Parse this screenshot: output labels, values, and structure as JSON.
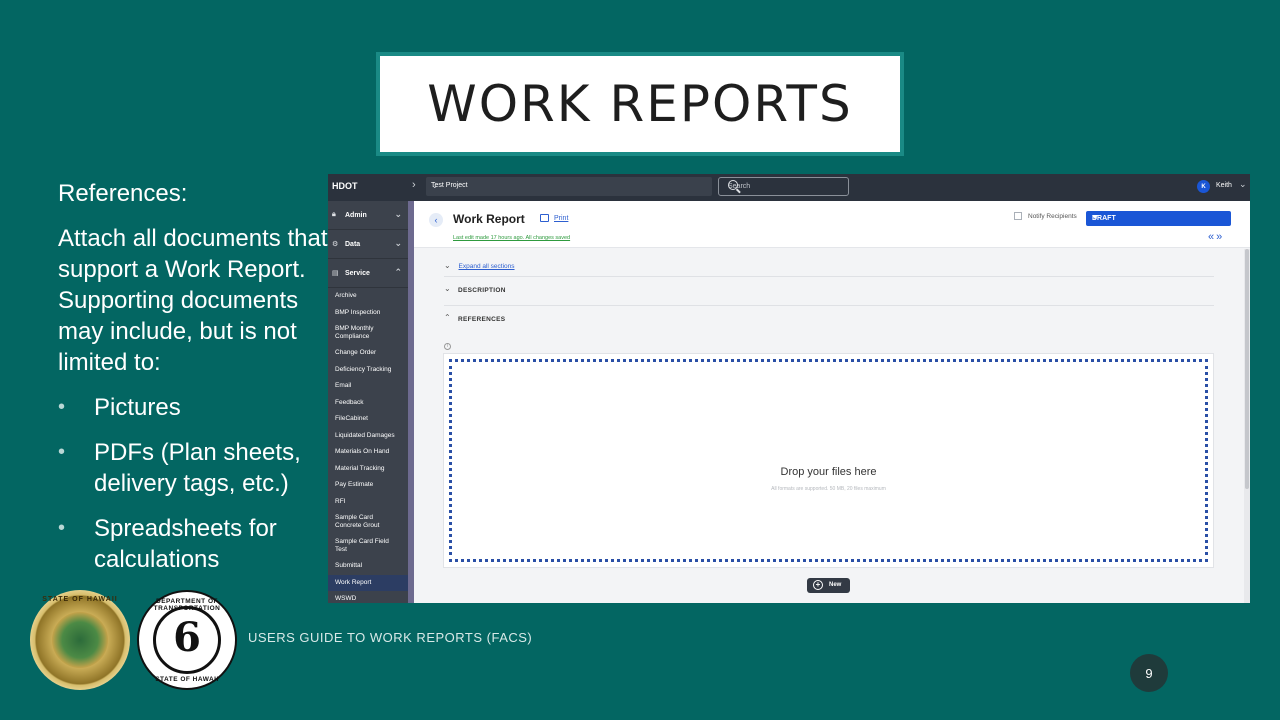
{
  "slide": {
    "title": "WORK REPORTS",
    "intro": "References:",
    "body": "Attach all documents that support a Work Report.  Supporting documents may include, but is not limited to:",
    "bullets": [
      "Pictures",
      "PDFs (Plan sheets, delivery tags, etc.)",
      "Spreadsheets for calculations"
    ],
    "footer": "USERS GUIDE TO WORK REPORTS  (FACS)",
    "page_number": "9"
  },
  "logos": {
    "state_seal_text": "STATE OF HAWAII",
    "dot_seal_top": "DEPARTMENT OF TRANSPORTATION",
    "dot_seal_bottom": "STATE OF HAWAII",
    "dot_seal_number": "6"
  },
  "app": {
    "topbar": {
      "brand": "HDOT",
      "project": "Test Project",
      "search_placeholder": "Search",
      "avatar_initial": "K",
      "user_name": "Keith"
    },
    "sidebar": {
      "groups": [
        {
          "label": "Admin",
          "icon": "lock-icon"
        },
        {
          "label": "Data",
          "icon": "gear-icon"
        },
        {
          "label": "Service",
          "icon": "document-icon"
        }
      ],
      "items": [
        "Archive",
        "BMP Inspection",
        "BMP Monthly Compliance",
        "Change Order",
        "Deficiency Tracking",
        "Email",
        "Feedback",
        "FileCabinet",
        "Liquidated Damages",
        "Materials On Hand",
        "Material Tracking",
        "Pay Estimate",
        "RFI",
        "Sample Card Concrete Grout",
        "Sample Card Field Test",
        "Submittal",
        "Work Report",
        "WSWD"
      ],
      "active_item": "Work Report"
    },
    "header": {
      "title": "Work Report",
      "print_label": "Print",
      "last_edit": "Last edit made 17 hours ago. All changes saved",
      "notify_label": "Notify Recipients",
      "status_value": "DRAFT"
    },
    "content": {
      "expand_all": "Expand all sections",
      "section_description": "DESCRIPTION",
      "section_references": "REFERENCES",
      "drop_title": "Drop your files here",
      "drop_subtitle": "All formats are supported. 50 MB, 20 files maximum",
      "new_button": "New"
    }
  }
}
